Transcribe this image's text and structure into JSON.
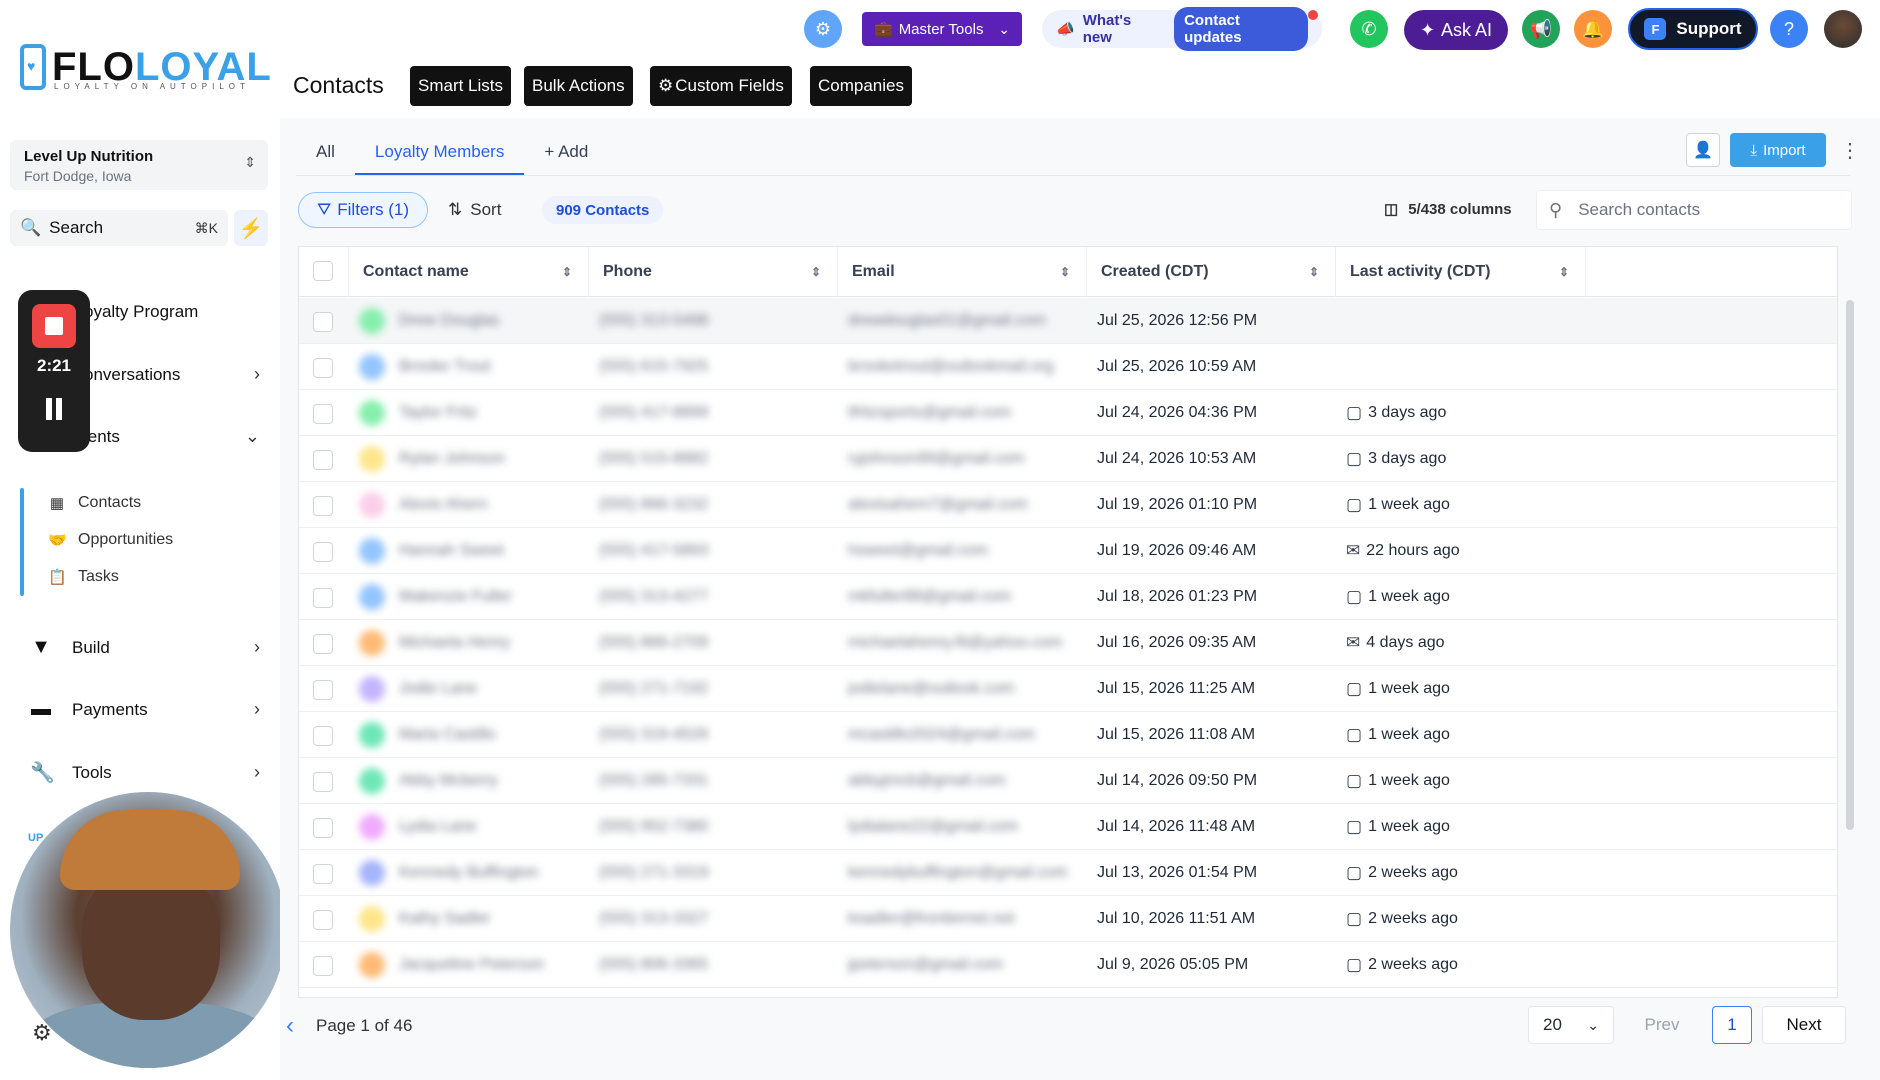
{
  "brand": {
    "logo_main": "FLO",
    "logo_accent": "LOYAL",
    "tagline": "LOYALTY ON AUTOPILOT"
  },
  "account": {
    "name": "Level Up Nutrition",
    "location": "Fort Dodge, Iowa"
  },
  "sidebar": {
    "search_label": "Search",
    "search_shortcut": "⌘K",
    "items": [
      {
        "label": "oyalty Program"
      },
      {
        "label": "onversations"
      },
      {
        "label": "ients"
      },
      {
        "label": "Build"
      },
      {
        "label": "Payments"
      },
      {
        "label": "Tools"
      }
    ],
    "sub_items": [
      {
        "label": "Contacts"
      },
      {
        "label": "Opportunities"
      },
      {
        "label": "Tasks"
      }
    ],
    "upgrade_label": "UP"
  },
  "recorder": {
    "time": "2:21"
  },
  "topbar": {
    "master_tools": "Master Tools",
    "whats_new": "What's new",
    "contact_updates": "Contact updates",
    "ask_ai": "Ask AI",
    "support": "Support",
    "help": "?"
  },
  "page": {
    "title": "Contacts",
    "buttons": [
      "Smart Lists",
      "Bulk Actions",
      "Custom Fields",
      "Companies"
    ]
  },
  "tabs": {
    "all": "All",
    "active": "Loyalty Members",
    "add": "Add"
  },
  "actions": {
    "import": "Import"
  },
  "toolbar": {
    "filters": "Filters (1)",
    "sort": "Sort",
    "count": "909 Contacts",
    "columns": "5/438 columns",
    "search_placeholder": "Search contacts"
  },
  "table": {
    "columns": [
      "Contact name",
      "Phone",
      "Email",
      "Created (CDT)",
      "Last activity (CDT)"
    ],
    "rows": [
      {
        "name": "Drew Douglas",
        "phone": "(555) 313-5498",
        "email": "drewdouglas01@gmail.com",
        "created": "Jul 25, 2026 12:56 PM",
        "activity": "",
        "activity_type": "",
        "avatar_color": "#86efac"
      },
      {
        "name": "Brooke Trout",
        "phone": "(555) 615-7925",
        "email": "brooketrout@outlookmail.org",
        "created": "Jul 25, 2026 10:59 AM",
        "activity": "",
        "activity_type": "",
        "avatar_color": "#93c5fd"
      },
      {
        "name": "Taylor Fritz",
        "phone": "(555) 417-8899",
        "email": "tfritzsports@gmail.com",
        "created": "Jul 24, 2026 04:36 PM",
        "activity": "3 days ago",
        "activity_type": "chat",
        "avatar_color": "#86efac"
      },
      {
        "name": "Rylan Johnson",
        "phone": "(555) 515-8882",
        "email": "ryjohnson99@gmail.com",
        "created": "Jul 24, 2026 10:53 AM",
        "activity": "3 days ago",
        "activity_type": "chat",
        "avatar_color": "#fde68a"
      },
      {
        "name": "Alexis Ahern",
        "phone": "(555) 866-3232",
        "email": "alexisahern7@gmail.com",
        "created": "Jul 19, 2026 01:10 PM",
        "activity": "1 week ago",
        "activity_type": "chat",
        "avatar_color": "#fbcfe8"
      },
      {
        "name": "Hannah Sweet",
        "phone": "(555) 417-5893",
        "email": "hsweet@gmail.com",
        "created": "Jul 19, 2026 09:46 AM",
        "activity": "22 hours ago",
        "activity_type": "mail",
        "avatar_color": "#93c5fd"
      },
      {
        "name": "Makenzie Fuller",
        "phone": "(555) 313-4277",
        "email": "mkfuller88@gmail.com",
        "created": "Jul 18, 2026 01:23 PM",
        "activity": "1 week ago",
        "activity_type": "chat",
        "avatar_color": "#93c5fd"
      },
      {
        "name": "Michaela Henry",
        "phone": "(555) 866-2709",
        "email": "michaelahenry.fit@yahoo.com",
        "created": "Jul 16, 2026 09:35 AM",
        "activity": "4 days ago",
        "activity_type": "mail",
        "avatar_color": "#fdba74"
      },
      {
        "name": "Jodie Lane",
        "phone": "(555) 271-7192",
        "email": "jodielane@outlook.com",
        "created": "Jul 15, 2026 11:25 AM",
        "activity": "1 week ago",
        "activity_type": "chat",
        "avatar_color": "#c4b5fd"
      },
      {
        "name": "Maria Castillo",
        "phone": "(555) 319-4526",
        "email": "mcastillo2024@gmail.com",
        "created": "Jul 15, 2026 11:08 AM",
        "activity": "1 week ago",
        "activity_type": "chat",
        "avatar_color": "#6ee7b7"
      },
      {
        "name": "Abby Mcberry",
        "phone": "(555) 285-7331",
        "email": "abbyjmcb@gmail.com",
        "created": "Jul 14, 2026 09:50 PM",
        "activity": "1 week ago",
        "activity_type": "chat",
        "avatar_color": "#6ee7b7"
      },
      {
        "name": "Lydia Lane",
        "phone": "(555) 952-7380",
        "email": "lydialane22@gmail.com",
        "created": "Jul 14, 2026 11:48 AM",
        "activity": "1 week ago",
        "activity_type": "chat",
        "avatar_color": "#f0abfc"
      },
      {
        "name": "Kennedy Buffington",
        "phone": "(555) 271-3319",
        "email": "kennedybuffington@gmail.com",
        "created": "Jul 13, 2026 01:54 PM",
        "activity": "2 weeks ago",
        "activity_type": "chat",
        "avatar_color": "#a5b4fc"
      },
      {
        "name": "Kathy Sadler",
        "phone": "(555) 313-3327",
        "email": "ksadler@frontiernet.net",
        "created": "Jul 10, 2026 11:51 AM",
        "activity": "2 weeks ago",
        "activity_type": "chat",
        "avatar_color": "#fde68a"
      },
      {
        "name": "Jacqueline Peterson",
        "phone": "(555) 806-3365",
        "email": "jpeterson@gmail.com",
        "created": "Jul 9, 2026 05:05 PM",
        "activity": "2 weeks ago",
        "activity_type": "chat",
        "avatar_color": "#fdba74"
      }
    ]
  },
  "pagination": {
    "text": "Page 1 of 46",
    "page_size": "20",
    "prev": "Prev",
    "current": "1",
    "next": "Next"
  },
  "colors": {
    "accent": "#3aa0e8",
    "primary": "#2563eb",
    "master_tools": "#5b21b6",
    "ask_ai": "#4c1d95"
  }
}
